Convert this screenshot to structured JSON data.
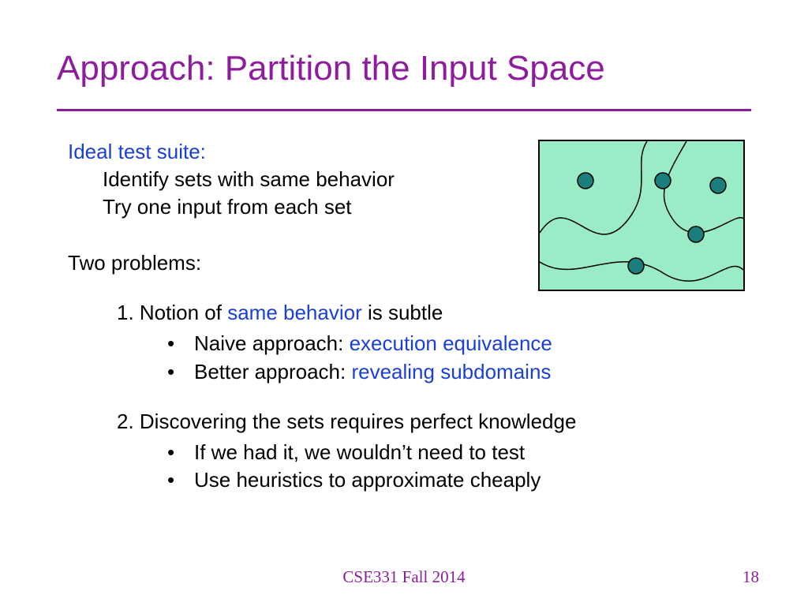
{
  "title": "Approach: Partition the Input Space",
  "ideal": {
    "heading": "Ideal test suite:",
    "line1": "Identify sets with same behavior",
    "line2": "Try one input from each set"
  },
  "problems_heading": "Two problems:",
  "p1": {
    "prefix": "1. Notion of ",
    "highlight": "same behavior",
    "suffix": " is subtle",
    "b1_prefix": "Naive approach: ",
    "b1_highlight": "execution equivalence",
    "b2_prefix": "Better approach: ",
    "b2_highlight": "revealing subdomains"
  },
  "p2": {
    "heading": "2. Discovering the sets requires perfect knowledge",
    "b1": "If we had it, we wouldn’t need to test",
    "b2": "Use heuristics to approximate cheaply"
  },
  "footer": {
    "course": "CSE331 Fall 2014",
    "page": "18"
  },
  "diagram": {
    "bg": "#99ecc5",
    "stroke": "#000000",
    "dot_fill": "#1a7e7c",
    "dot_stroke": "#000000"
  }
}
